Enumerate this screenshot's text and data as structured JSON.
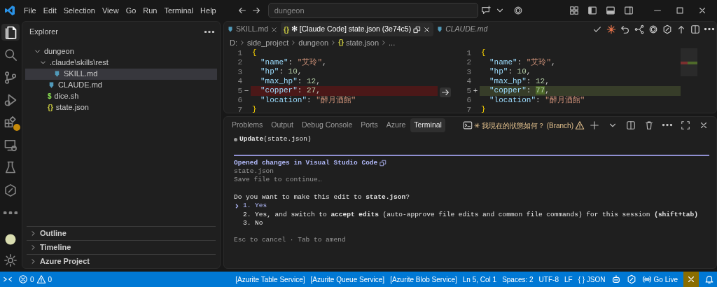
{
  "window": {
    "menu": [
      "File",
      "Edit",
      "Selection",
      "View",
      "Go",
      "Run",
      "Terminal",
      "Help"
    ],
    "search": {
      "value": "dungeon"
    }
  },
  "activity_bar": [
    {
      "kind": "files",
      "selected": true,
      "warning": false
    },
    {
      "kind": "search",
      "selected": false,
      "warning": false
    },
    {
      "kind": "branch",
      "selected": false,
      "warning": false
    },
    {
      "kind": "debug",
      "selected": false,
      "warning": false
    },
    {
      "kind": "extensions",
      "selected": false,
      "warning": true
    },
    {
      "kind": "remote",
      "selected": false,
      "warning": false
    },
    {
      "kind": "flask",
      "selected": false,
      "warning": false
    },
    {
      "kind": "hex",
      "selected": false,
      "warning": false
    },
    {
      "kind": "more",
      "selected": false,
      "warning": false
    }
  ],
  "sidebar": {
    "title": "Explorer",
    "tree": [
      {
        "label": "dungeon",
        "kind": "folder",
        "expanded": true,
        "selected": false,
        "children": [
          {
            "label": ".claude\\skills\\rest",
            "kind": "folder",
            "expanded": true,
            "selected": false,
            "children": [
              {
                "label": "SKILL.md",
                "kind": "markdown",
                "selected": true
              }
            ]
          },
          {
            "label": "CLAUDE.md",
            "kind": "markdown",
            "selected": false
          },
          {
            "label": "dice.sh",
            "kind": "shell",
            "icon_text": "$",
            "selected": false
          },
          {
            "label": "state.json",
            "kind": "json",
            "icon_text": "{}",
            "selected": false
          }
        ]
      }
    ],
    "sections": [
      {
        "label": "Outline",
        "expanded": false
      },
      {
        "label": "Timeline",
        "expanded": false
      },
      {
        "label": "Azure Project",
        "expanded": false
      }
    ]
  },
  "editor": {
    "tabs": [
      {
        "label": "SKILL.md",
        "kind": "markdown",
        "selected": false,
        "preview": false,
        "closable": true
      },
      {
        "label": "✻ [Claude Code] state.json (3e74c5)",
        "kind": "json",
        "icon_text": "{}",
        "selected": true,
        "preview": false,
        "closable": true
      },
      {
        "label": "CLAUDE.md",
        "kind": "markdown",
        "selected": false,
        "preview": true,
        "closable": false
      }
    ],
    "breadcrumb": [
      {
        "label": "D:"
      },
      {
        "label": "side_project"
      },
      {
        "label": "dungeon"
      },
      {
        "label": "state.json",
        "icon_text": "{}"
      },
      {
        "label": "..."
      }
    ],
    "diff_left": [
      {
        "number": "1",
        "kind": "brace",
        "removed": false,
        "tokens": [
          {
            "kind": "brace",
            "text": "{"
          }
        ]
      },
      {
        "number": "2",
        "kind": "member",
        "removed": false,
        "tokens": [
          {
            "kind": "key",
            "text": "\"name\""
          },
          {
            "kind": "punct",
            "text": ": "
          },
          {
            "kind": "string",
            "text": "\"艾玲\""
          },
          {
            "kind": "punct",
            "text": ","
          }
        ]
      },
      {
        "number": "3",
        "kind": "member",
        "removed": false,
        "tokens": [
          {
            "kind": "key",
            "text": "\"hp\""
          },
          {
            "kind": "punct",
            "text": ": "
          },
          {
            "kind": "number",
            "text": "10"
          },
          {
            "kind": "punct",
            "text": ","
          }
        ]
      },
      {
        "number": "4",
        "kind": "member",
        "removed": false,
        "tokens": [
          {
            "kind": "key",
            "text": "\"max_hp\""
          },
          {
            "kind": "punct",
            "text": ": "
          },
          {
            "kind": "number",
            "text": "12"
          },
          {
            "kind": "punct",
            "text": ","
          }
        ]
      },
      {
        "number": "5",
        "marker": "−",
        "kind": "member",
        "removed": true,
        "tokens": [
          {
            "kind": "key",
            "text": "\"copper\""
          },
          {
            "kind": "punct",
            "text": ": "
          },
          {
            "kind": "number",
            "text": "27"
          },
          {
            "kind": "punct",
            "text": ","
          }
        ]
      },
      {
        "number": "6",
        "kind": "member",
        "removed": false,
        "tokens": [
          {
            "kind": "key",
            "text": "\"location\""
          },
          {
            "kind": "punct",
            "text": ": "
          },
          {
            "kind": "string",
            "text": "\"醉月酒館\""
          }
        ]
      },
      {
        "number": "7",
        "kind": "brace",
        "removed": false,
        "tokens": [
          {
            "kind": "brace",
            "text": "}"
          }
        ]
      }
    ],
    "diff_right": [
      {
        "number": "1",
        "kind": "brace",
        "added": false,
        "tokens": [
          {
            "kind": "brace",
            "text": "{"
          }
        ]
      },
      {
        "number": "2",
        "kind": "member",
        "added": false,
        "tokens": [
          {
            "kind": "key",
            "text": "\"name\""
          },
          {
            "kind": "punct",
            "text": ": "
          },
          {
            "kind": "string",
            "text": "\"艾玲\""
          },
          {
            "kind": "punct",
            "text": ","
          }
        ]
      },
      {
        "number": "3",
        "kind": "member",
        "added": false,
        "tokens": [
          {
            "kind": "key",
            "text": "\"hp\""
          },
          {
            "kind": "punct",
            "text": ": "
          },
          {
            "kind": "number",
            "text": "10"
          },
          {
            "kind": "punct",
            "text": ","
          }
        ]
      },
      {
        "number": "4",
        "kind": "member",
        "added": false,
        "tokens": [
          {
            "kind": "key",
            "text": "\"max_hp\""
          },
          {
            "kind": "punct",
            "text": ": "
          },
          {
            "kind": "number",
            "text": "12"
          },
          {
            "kind": "punct",
            "text": ","
          }
        ]
      },
      {
        "number": "5",
        "marker": "+",
        "kind": "member",
        "added": true,
        "tokens": [
          {
            "kind": "key",
            "text": "\"copper\""
          },
          {
            "kind": "punct",
            "text": ": "
          },
          {
            "kind": "number",
            "text": "77",
            "changed": true
          },
          {
            "kind": "punct",
            "text": ","
          }
        ]
      },
      {
        "number": "6",
        "kind": "member",
        "added": false,
        "tokens": [
          {
            "kind": "key",
            "text": "\"location\""
          },
          {
            "kind": "punct",
            "text": ": "
          },
          {
            "kind": "string",
            "text": "\"醉月酒館\""
          }
        ]
      },
      {
        "number": "7",
        "kind": "brace",
        "added": false,
        "tokens": [
          {
            "kind": "brace",
            "text": "}"
          }
        ]
      }
    ]
  },
  "panel": {
    "tabs": [
      {
        "label": "Problems",
        "selected": false
      },
      {
        "label": "Output",
        "selected": false
      },
      {
        "label": "Debug Console",
        "selected": false
      },
      {
        "label": "Ports",
        "selected": false
      },
      {
        "label": "Azure",
        "selected": false
      },
      {
        "label": "Terminal",
        "selected": true
      }
    ],
    "terminal_title": "✳ 我現在的狀態如何？ (Branch)",
    "lines": [
      {
        "kind": "bullet",
        "text": "**Update**(state.json)"
      },
      {
        "kind": "rule"
      },
      {
        "kind": "heading",
        "text": "Opened changes in Visual Studio Code"
      },
      {
        "kind": "text",
        "text": "state.json"
      },
      {
        "kind": "text",
        "text": "Save file to continue…"
      },
      {
        "kind": "blank"
      },
      {
        "kind": "question",
        "text": "Do you want to make this edit to **state.json**?"
      },
      {
        "kind": "option",
        "text": "1. Yes",
        "selected": true
      },
      {
        "kind": "option",
        "text": "2. Yes, and switch to **accept edits** (auto-approve file edits and common file commands) for this session **(shift+tab)**",
        "selected": false
      },
      {
        "kind": "option",
        "text": "3. No",
        "selected": false
      },
      {
        "kind": "blank"
      },
      {
        "kind": "hint",
        "text": "Esc to cancel · Tab to amend"
      }
    ]
  },
  "status_bar": {
    "errors": "0",
    "warnings": "0",
    "items": [
      {
        "text": "[Azurite Table Service]"
      },
      {
        "text": "[Azurite Queue Service]"
      },
      {
        "text": "[Azurite Blob Service]"
      },
      {
        "text": "Ln 5, Col 1"
      },
      {
        "text": "Spaces: 2"
      },
      {
        "text": "UTF-8"
      },
      {
        "text": "LF"
      },
      {
        "text": "JSON",
        "icon_text": "{ }"
      }
    ],
    "go_live": "Go Live"
  }
}
